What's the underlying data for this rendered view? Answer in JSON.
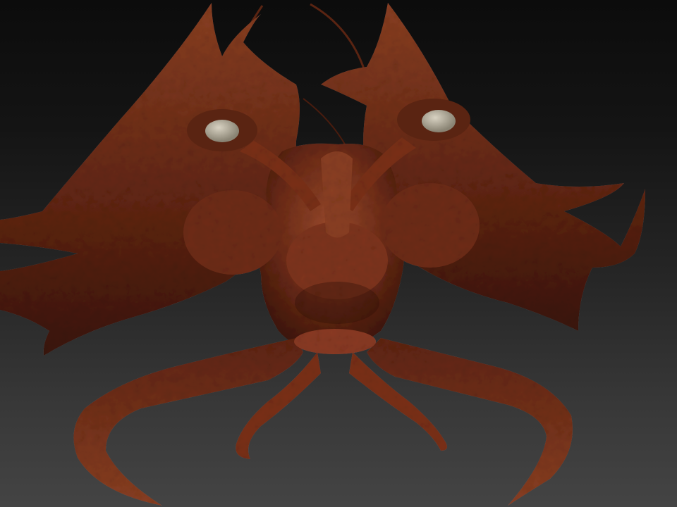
{
  "viewport": {
    "subject": "sculpted-creature",
    "colors": {
      "background_top": "#0c0c0c",
      "background_bottom": "#444444",
      "flesh_dark": "#3a140a",
      "flesh_mid": "#6e2c17",
      "flesh_light": "#9a4a2c",
      "eye": "#b9b3a2"
    }
  }
}
